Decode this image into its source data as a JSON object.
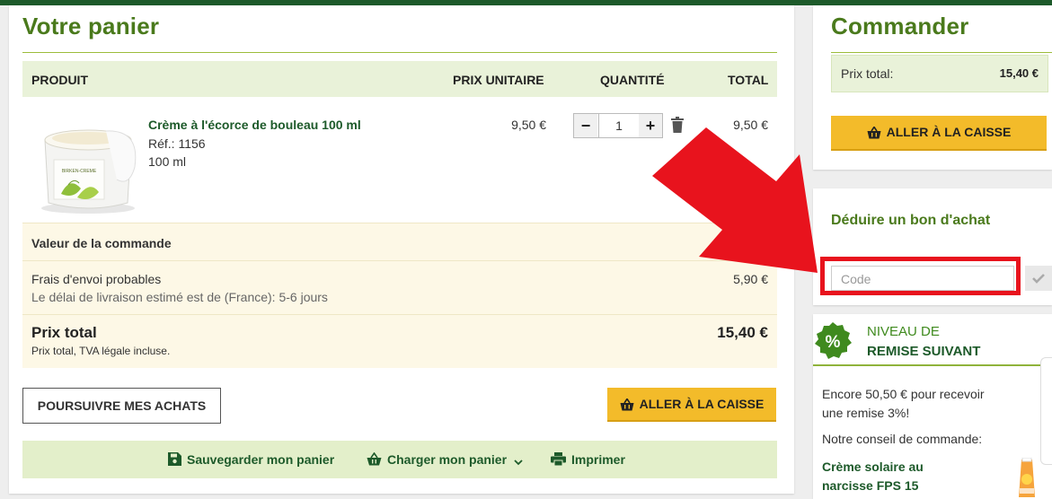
{
  "cart": {
    "title": "Votre panier",
    "headers": {
      "product": "PRODUIT",
      "unit_price": "PRIX UNITAIRE",
      "quantity": "QUANTITÉ",
      "total": "TOTAL"
    },
    "item": {
      "name": "Crème à  l'écorce de bouleau 100 ml",
      "ref": "Réf.: 1156",
      "size": "100 ml",
      "unit_price": "9,50 €",
      "quantity": "1",
      "total": "9,50 €",
      "jar_label": "BIRKEN-CREME"
    },
    "summary": {
      "order_value_label": "Valeur de la commande",
      "shipping_label": "Frais d'envoi probables",
      "shipping_delay": "Le délai de livraison estimé est de (France): 5-6 jours",
      "shipping_value": "5,90 €",
      "total_label": "Prix total",
      "total_note": "Prix total, TVA légale incluse.",
      "total_value": "15,40 €"
    },
    "continue_button": "POURSUIVRE MES ACHATS",
    "checkout_button": "ALLER À LA CAISSE",
    "actions": {
      "save": "Sauvegarder mon panier",
      "load": "Charger mon panier",
      "print": "Imprimer"
    }
  },
  "order": {
    "title": "Commander",
    "total_label": "Prix total:",
    "total_value": "15,40 €",
    "checkout_button": "ALLER À LA CAISSE"
  },
  "voucher": {
    "title": "Déduire un bon d'achat",
    "placeholder": "Code"
  },
  "discount": {
    "badge": "%",
    "title_line1": "NIVEAU DE",
    "title_line2": "REMISE SUIVANT",
    "message": "Encore 50,50 € pour recevoir une remise 3%!",
    "tip_label": "Notre conseil de commande:",
    "tip_product": "Crème solaire au narcisse FPS 15"
  },
  "colors": {
    "brand_green": "#4a7a1c",
    "dark_green": "#1d5a2a",
    "checkout_yellow": "#f3bb2a",
    "highlight_red": "#e8131d"
  }
}
